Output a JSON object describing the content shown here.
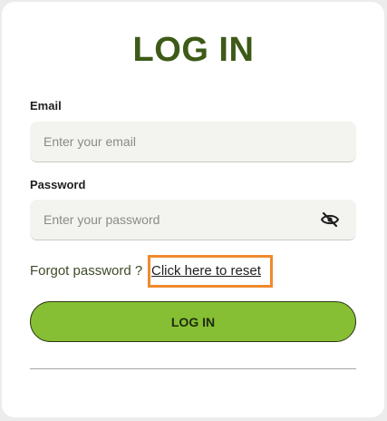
{
  "login": {
    "title": "LOG IN",
    "email_label": "Email",
    "email_placeholder": "Enter your email",
    "email_value": "",
    "password_label": "Password",
    "password_placeholder": "Enter your password",
    "password_value": "",
    "password_toggle_icon": "eye-slash-icon",
    "forgot_text": "Forgot password ?",
    "reset_link": "Click here to reset",
    "submit_label": "LOG IN"
  },
  "colors": {
    "title": "#3d5a17",
    "button": "#86bf34",
    "highlight_box": "#f08a2c",
    "input_bg": "#f3f3ef"
  }
}
